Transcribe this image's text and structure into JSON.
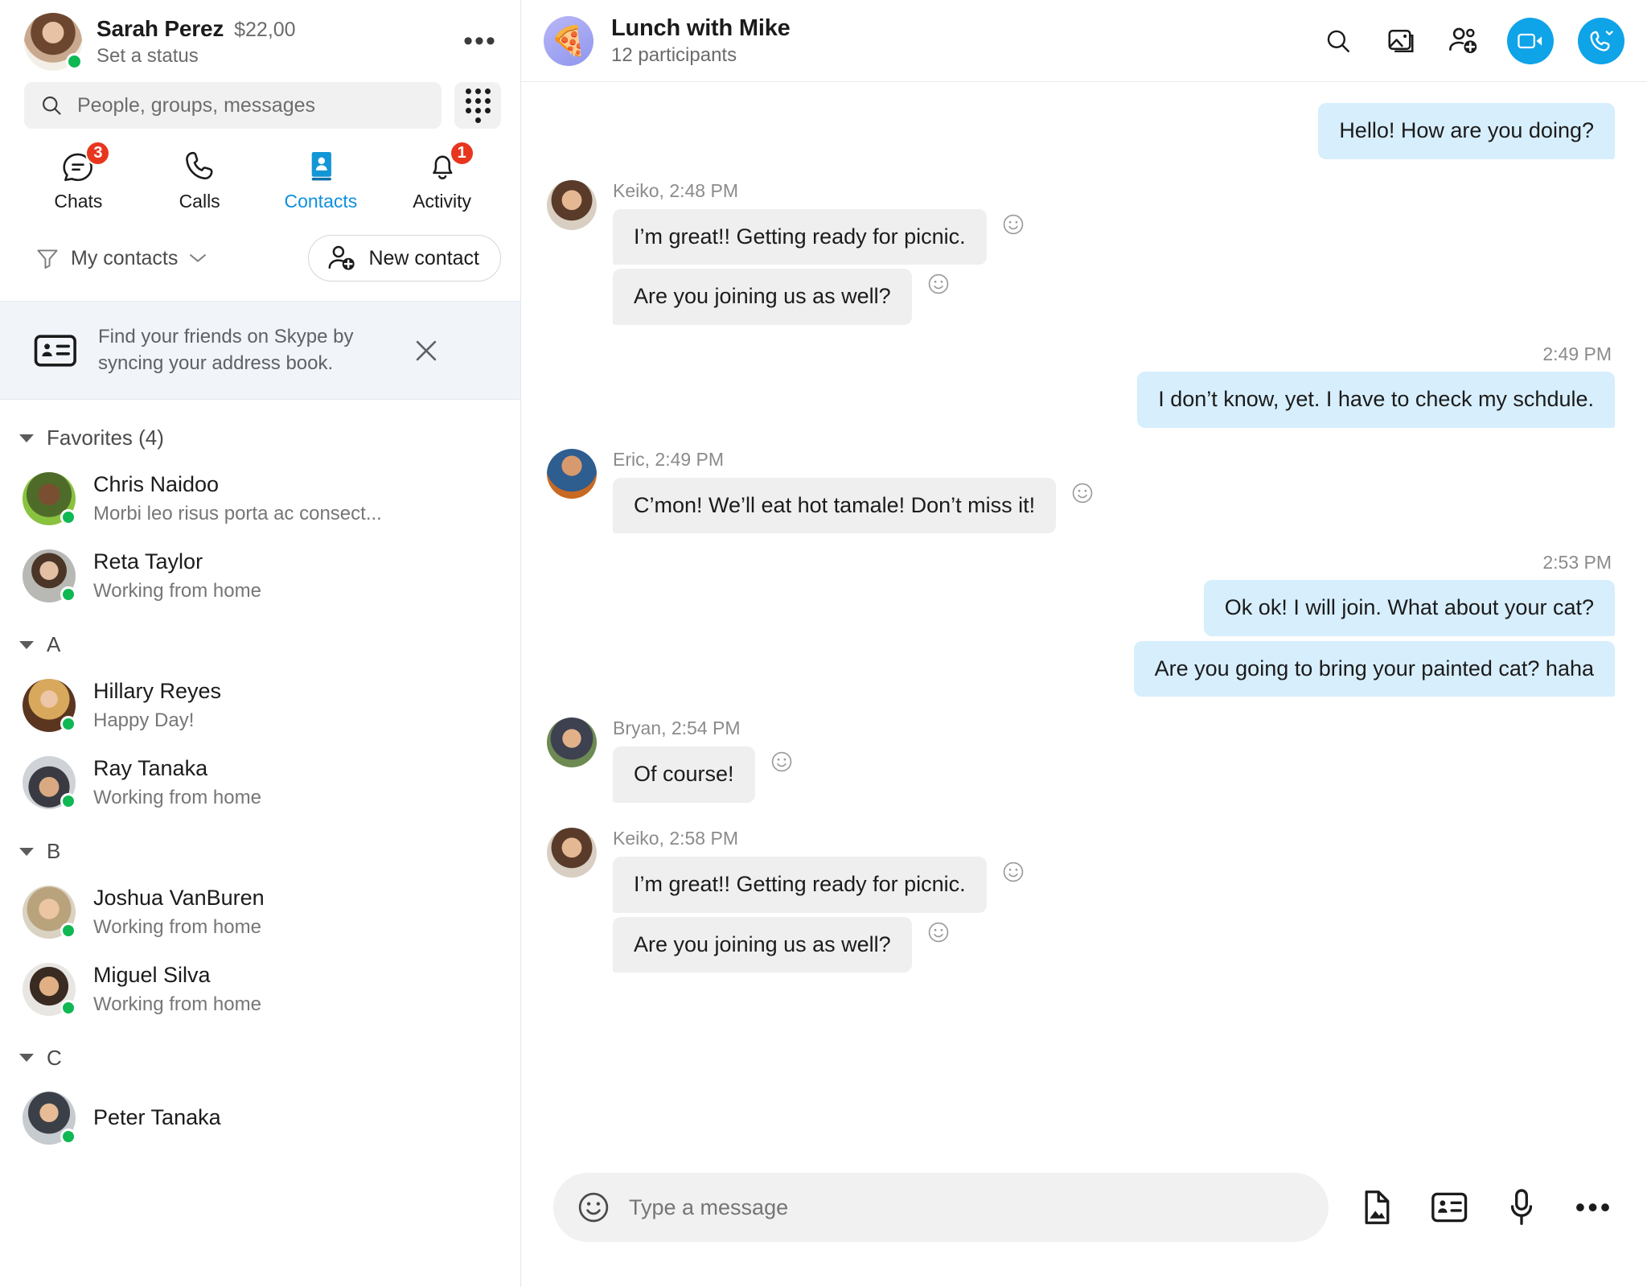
{
  "sidebar": {
    "profile": {
      "name": "Sarah Perez",
      "credit": "$22,00",
      "status": "Set a status",
      "avatar": "ph-sarah"
    },
    "more_label": "•••",
    "search": {
      "placeholder": "People, groups, messages",
      "icon": "search-icon"
    },
    "dialpad_icon": "dialpad-icon",
    "tabs": [
      {
        "label": "Chats",
        "icon": "chat-bubble-icon",
        "badge": "3",
        "active": false
      },
      {
        "label": "Calls",
        "icon": "phone-icon",
        "badge": "",
        "active": false
      },
      {
        "label": "Contacts",
        "icon": "contacts-book-icon",
        "badge": "",
        "active": true
      },
      {
        "label": "Activity",
        "icon": "bell-icon",
        "badge": "1",
        "active": false
      }
    ],
    "filter": {
      "label": "My contacts",
      "icon": "funnel-icon",
      "chevron": "chevron-down-icon"
    },
    "new_contact": {
      "label": "New contact",
      "icon": "add-person-icon"
    },
    "banner": {
      "text": "Find your friends on Skype by syncing your address book.",
      "icon": "address-book-icon",
      "close": "close-icon"
    },
    "groups": [
      {
        "title": "Favorites (4)",
        "contacts": [
          {
            "name": "Chris Naidoo",
            "status": "Morbi leo risus porta ac consect...",
            "presence": "online",
            "avatar": "ph-chris"
          },
          {
            "name": "Reta Taylor",
            "status": "Working from home",
            "presence": "online",
            "avatar": "ph-reta"
          }
        ]
      },
      {
        "title": "A",
        "contacts": [
          {
            "name": "Hillary Reyes",
            "status": "Happy Day!",
            "presence": "online",
            "avatar": "ph-hill"
          },
          {
            "name": "Ray Tanaka",
            "status": "Working from home",
            "presence": "online",
            "avatar": "ph-ray"
          }
        ]
      },
      {
        "title": "B",
        "contacts": [
          {
            "name": "Joshua VanBuren",
            "status": "Working from home",
            "presence": "online",
            "avatar": "ph-josh"
          },
          {
            "name": "Miguel Silva",
            "status": "Working from home",
            "presence": "online",
            "avatar": "ph-mig"
          }
        ]
      },
      {
        "title": "C",
        "contacts": [
          {
            "name": "Peter Tanaka",
            "status": "",
            "presence": "online",
            "avatar": "ph-peter"
          }
        ]
      }
    ]
  },
  "chat": {
    "header": {
      "title": "Lunch with Mike",
      "subtitle": "12 participants",
      "avatar_emoji": "🍕",
      "actions": [
        {
          "name": "search-icon"
        },
        {
          "name": "gallery-icon"
        },
        {
          "name": "add-people-icon"
        }
      ],
      "video_call": "video-call-icon",
      "audio_call": "audio-call-icon"
    },
    "messages": [
      {
        "kind": "out",
        "text": "Hello! How are you doing?",
        "time": ""
      },
      {
        "kind": "in",
        "sender": "Keiko",
        "time": "2:48 PM",
        "avatar": "ph-keiko",
        "bubbles": [
          "I’m great!! Getting ready for picnic.",
          "Are you joining us as well?"
        ]
      },
      {
        "kind": "out",
        "text": "I don’t know, yet. I have to check my schdule.",
        "time": "2:49 PM"
      },
      {
        "kind": "in",
        "sender": "Eric",
        "time": "2:49 PM",
        "avatar": "ph-eric",
        "bubbles": [
          "C’mon! We’ll eat hot tamale! Don’t miss it!"
        ]
      },
      {
        "kind": "out",
        "text": "Ok ok! I will join. What about your cat?",
        "time": "2:53 PM"
      },
      {
        "kind": "out",
        "text": "Are you going to bring your painted cat? haha",
        "time": ""
      },
      {
        "kind": "in",
        "sender": "Bryan",
        "time": "2:54 PM",
        "avatar": "ph-bryan",
        "bubbles": [
          "Of course!"
        ]
      },
      {
        "kind": "in",
        "sender": "Keiko",
        "time": "2:58 PM",
        "avatar": "ph-keiko",
        "bubbles": [
          "I’m great!! Getting ready for picnic.",
          "Are you joining us as well?"
        ]
      }
    ],
    "compose": {
      "placeholder": "Type a message",
      "emoji_icon": "emoji-icon",
      "icons": [
        {
          "name": "file-image-icon"
        },
        {
          "name": "contact-card-icon"
        },
        {
          "name": "microphone-icon"
        },
        {
          "name": "more-options-icon"
        }
      ]
    }
  },
  "colors": {
    "accent": "#0fa3e8",
    "badge": "#e8361e",
    "presence_online": "#0fb853",
    "out_bubble": "#d7eefc",
    "in_bubble": "#efefef"
  }
}
